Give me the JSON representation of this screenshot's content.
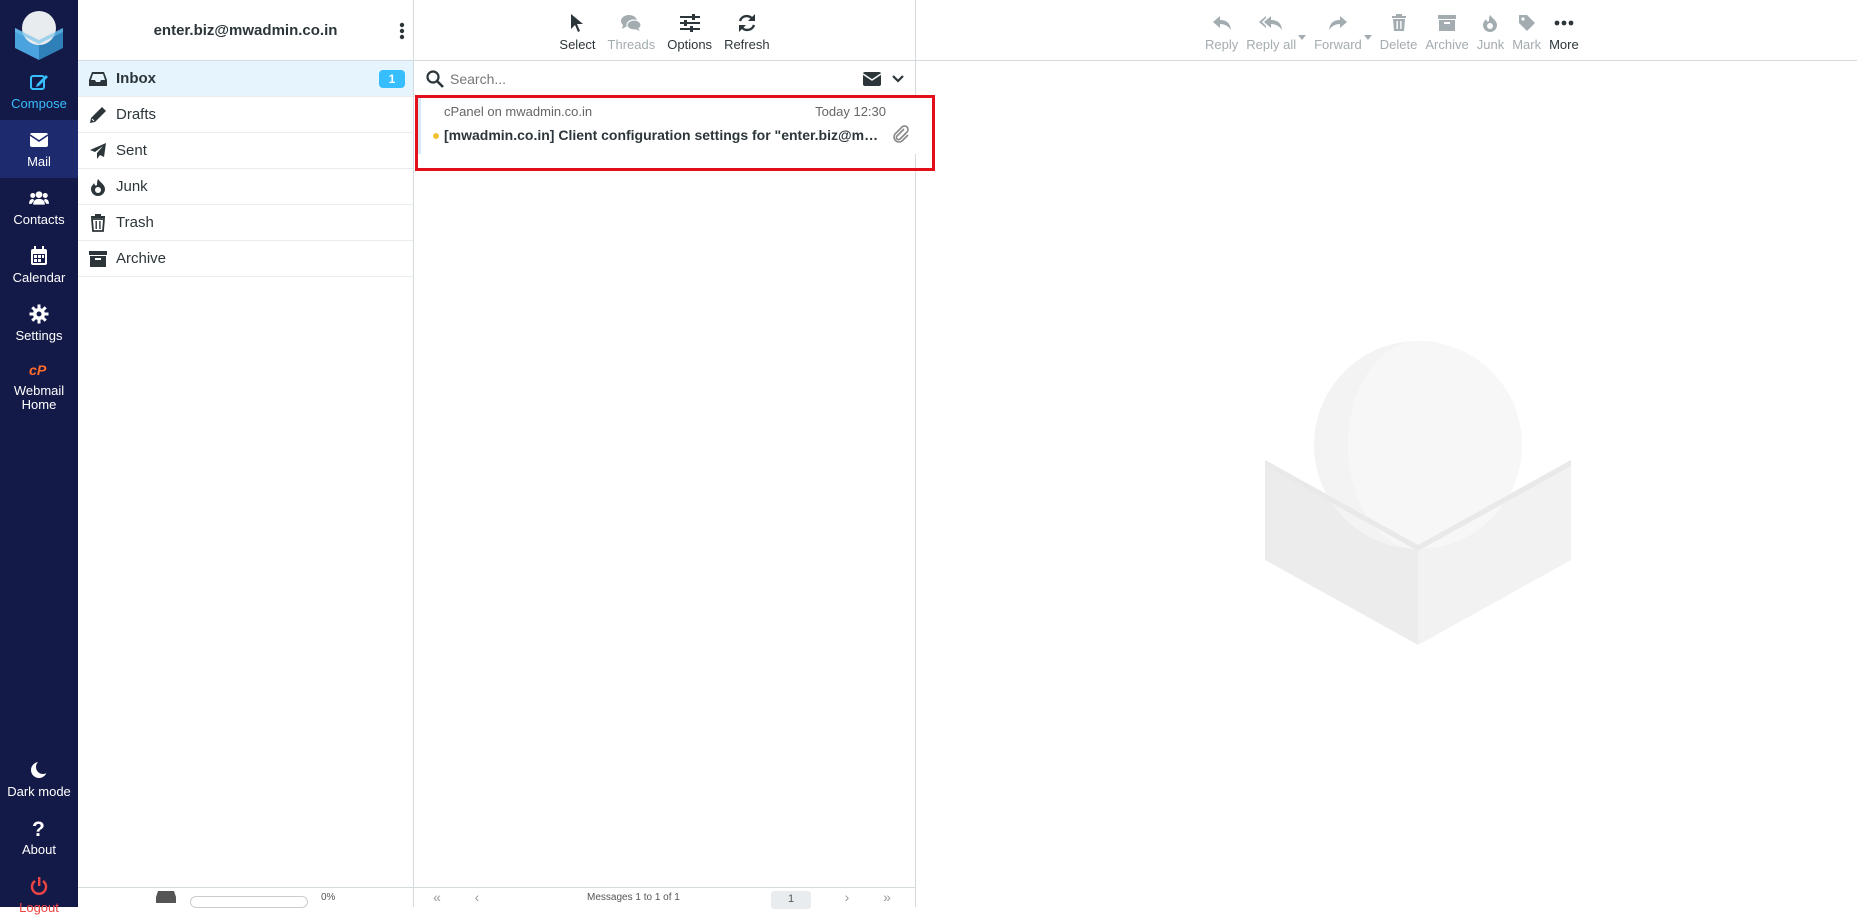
{
  "nav": {
    "items": [
      {
        "id": "compose",
        "label": "Compose",
        "icon": "compose-icon"
      },
      {
        "id": "mail",
        "label": "Mail",
        "icon": "envelope-icon"
      },
      {
        "id": "contacts",
        "label": "Contacts",
        "icon": "users-icon"
      },
      {
        "id": "calendar",
        "label": "Calendar",
        "icon": "calendar-icon"
      },
      {
        "id": "settings",
        "label": "Settings",
        "icon": "gear-icon"
      },
      {
        "id": "webmail",
        "label": "Webmail Home",
        "icon": "cpanel-icon"
      }
    ],
    "bottom": {
      "dark_mode": "Dark mode",
      "about": "About",
      "logout": "Logout"
    }
  },
  "folders": {
    "account": "enter.biz@mwadmin.co.in",
    "items": [
      {
        "label": "Inbox",
        "icon": "inbox-icon",
        "unread": "1",
        "active": true
      },
      {
        "label": "Drafts",
        "icon": "pencil-icon"
      },
      {
        "label": "Sent",
        "icon": "paper-plane-icon"
      },
      {
        "label": "Junk",
        "icon": "fire-icon"
      },
      {
        "label": "Trash",
        "icon": "trash-icon"
      },
      {
        "label": "Archive",
        "icon": "archive-icon"
      }
    ],
    "quota": "0%"
  },
  "list_toolbar": {
    "select": "Select",
    "threads": "Threads",
    "options": "Options",
    "refresh": "Refresh"
  },
  "search": {
    "placeholder": "Search..."
  },
  "messages": [
    {
      "from": "cPanel on mwadmin.co.in",
      "date": "Today 12:30",
      "subject": "[mwadmin.co.in] Client configuration settings for \"enter.biz@mwadmin.co.in\"",
      "unread": true,
      "has_attachment": true
    }
  ],
  "pager": {
    "text": "Messages 1 to 1 of 1",
    "page": "1"
  },
  "preview_toolbar": {
    "reply": "Reply",
    "reply_all": "Reply all",
    "forward": "Forward",
    "delete": "Delete",
    "archive": "Archive",
    "junk": "Junk",
    "mark": "Mark",
    "more": "More"
  },
  "colors": {
    "nav_bg": "#141a47",
    "accent": "#37beff",
    "highlight": "#e3101c",
    "unread_dot": "#f1c232"
  }
}
